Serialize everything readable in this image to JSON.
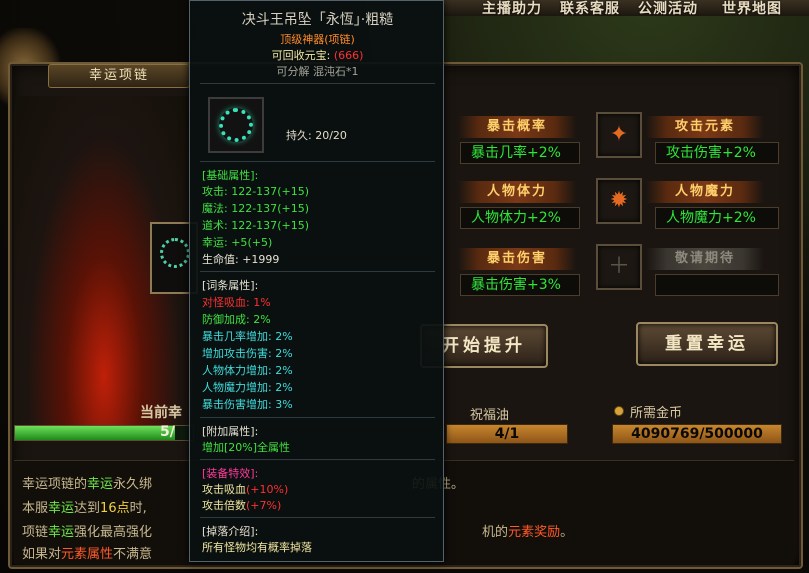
{
  "topbar": {
    "items": [
      "主播助力",
      "联系客服",
      "公测活动",
      "世界地图"
    ]
  },
  "panel": {
    "title": "幸运项链",
    "level_label": "当前幸",
    "progress_text": "5/",
    "progress_fraction": 0.9
  },
  "attributes": [
    {
      "name": "暴击概率",
      "value": "暴击几率+2%",
      "icon": "crit-chance-icon"
    },
    {
      "name": "攻击元素",
      "value": "攻击伤害+2%",
      "icon": "attack-element-icon"
    },
    {
      "name": "人物体力",
      "value": "人物体力+2%",
      "icon": "stamina-icon"
    },
    {
      "name": "人物魔力",
      "value": "人物魔力+2%",
      "icon": "mana-icon"
    },
    {
      "name": "暴击伤害",
      "value": "暴击伤害+3%",
      "icon": "crit-damage-icon"
    },
    {
      "name": "敬请期待",
      "value": "",
      "icon": "locked-slot-icon"
    }
  ],
  "buttons": {
    "start": "开始提升",
    "reset": "重置幸运"
  },
  "costs": {
    "oil_label": "祝福油",
    "oil_value": "4/1",
    "gold_label": "所需金币",
    "gold_value": "4090769/500000"
  },
  "description": {
    "lines": [
      [
        "幸运项链的",
        "幸运",
        "永久绑",
        "的属性。"
      ],
      [
        "本服",
        "幸运",
        "达到",
        "16点",
        "时,"
      ],
      [
        "项链",
        "幸运",
        "强化最高强化",
        "机的",
        "元素奖励",
        "。"
      ],
      [
        "如果对",
        "元素属性",
        "不满意"
      ]
    ]
  },
  "tooltip": {
    "title": "决斗王吊坠「永恆」·粗糙",
    "grade": "顶级神器(项链)",
    "recycle_label": "可回收元宝:",
    "recycle_value": "(666)",
    "decompose": "可分解 混沌石*1",
    "durability": "持久: 20/20",
    "base_header": "[基础属性]:",
    "base_stats": [
      {
        "label": "攻击:",
        "value": "122-137",
        "bonus": "(+15)"
      },
      {
        "label": "魔法:",
        "value": "122-137",
        "bonus": "(+15)"
      },
      {
        "label": "道术:",
        "value": "122-137",
        "bonus": "(+15)"
      },
      {
        "label": "幸运:",
        "value": "+5",
        "bonus": "(+5)"
      }
    ],
    "hp_line": "生命值: +1999",
    "affix_header": "[词条属性]:",
    "affixes": [
      {
        "text": "对怪吸血: 1%",
        "color": "#ff3030"
      },
      {
        "text": "防御加成: 2%",
        "color": "#40e040"
      },
      {
        "text": "暴击几率增加: 2%",
        "color": "#40dcdc"
      },
      {
        "text": "增加攻击伤害: 2%",
        "color": "#40dcdc"
      },
      {
        "text": "人物体力增加: 2%",
        "color": "#40dcdc"
      },
      {
        "text": "人物魔力增加: 2%",
        "color": "#40dcdc"
      },
      {
        "text": "暴击伤害增加: 3%",
        "color": "#40dcdc"
      }
    ],
    "extra_header": "[附加属性]:",
    "extra_line": "增加[20%]全属性",
    "special_header": "[装备特效]:",
    "special": [
      {
        "label": "攻击吸血",
        "value": "(+10%)"
      },
      {
        "label": "攻击倍数",
        "value": "(+7%)"
      }
    ],
    "drop_header": "[掉落介绍]:",
    "drop_line": "所有怪物均有概率掉落"
  },
  "colors": {
    "accent_green": "#2de638",
    "gold": "#c7862e",
    "tag_text": "#ffcf6a"
  }
}
